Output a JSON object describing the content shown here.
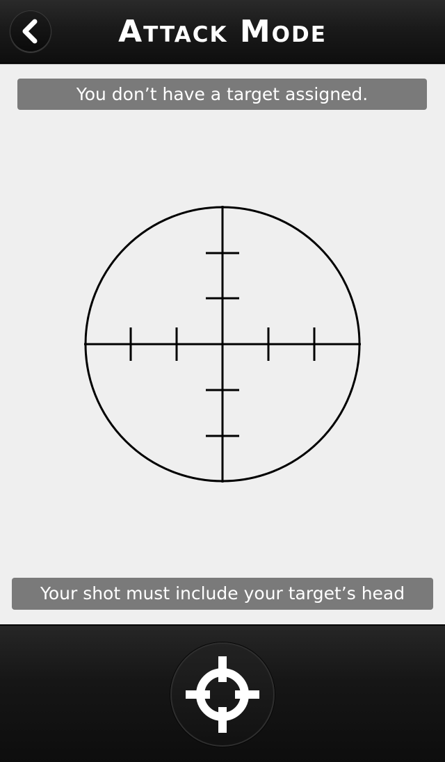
{
  "header": {
    "title": "Attack Mode",
    "back_icon": "chevron-left-icon"
  },
  "status": {
    "top_message": "You don’t have a target assigned.",
    "bottom_message": "Your shot must include your target’s head"
  },
  "reticle": {
    "icon": "scope-reticle-icon"
  },
  "footer": {
    "shoot_icon": "crosshair-icon"
  },
  "colors": {
    "bar_background": "#111111",
    "banner_background": "#7a7a7a",
    "screen_background": "#efefef",
    "text": "#ffffff",
    "reticle": "#000000"
  }
}
